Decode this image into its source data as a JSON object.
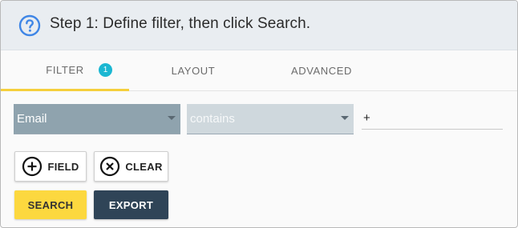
{
  "header": {
    "title": "Step 1: Define filter, then click Search."
  },
  "tabs": [
    {
      "label": "FILTER",
      "badge": "1",
      "active": true
    },
    {
      "label": "LAYOUT",
      "active": false
    },
    {
      "label": "ADVANCED",
      "active": false
    }
  ],
  "filter_row": {
    "field_select": "Email",
    "operator_select": "contains",
    "value": "+"
  },
  "buttons": {
    "field": "FIELD",
    "clear": "CLEAR",
    "search": "SEARCH",
    "export": "EXPORT"
  },
  "icons": {
    "help": "help-circle-icon",
    "field": "add-circle-icon",
    "clear": "close-circle-icon"
  },
  "colors": {
    "accent_tab": "#f5cf3c",
    "badge": "#1bb7d2",
    "search_button": "#fcd83f",
    "export_button": "#2f4457",
    "help_icon": "#3f86e6"
  }
}
